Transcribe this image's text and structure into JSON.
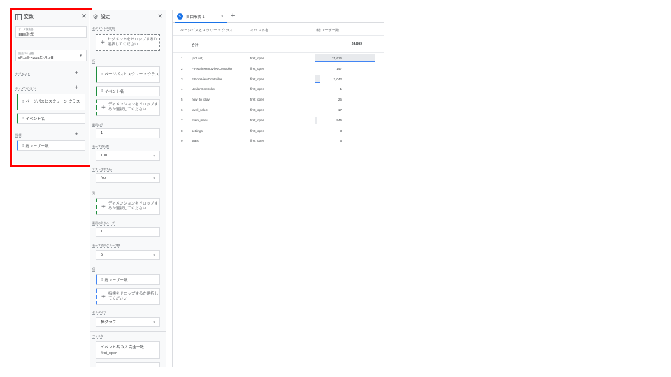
{
  "variables": {
    "title": "変数",
    "name_label": "データ探索名:",
    "name_value": "自由形式",
    "date_label": "過去 28 日間",
    "date_value": "6月13日～2025年7月10日",
    "segments_label": "セグメント",
    "dimensions_label": "ディメンション",
    "dimensions": [
      "ページパスとスクリーン クラス",
      "イベント名"
    ],
    "metrics_label": "指標",
    "metrics": [
      "総ユーザー数"
    ]
  },
  "settings": {
    "title": "設定",
    "segment_compare_label": "セグメントの比較",
    "segment_drop": "セグメントをドロップするか選択してください",
    "rows_label": "行",
    "rows": [
      "ページパスとスクリーン クラス",
      "イベント名"
    ],
    "rows_drop": "ディメンションをドロップするか選択してください",
    "start_row_label": "最初の行",
    "start_row_value": "1",
    "show_rows_label": "表示する行数",
    "show_rows_value": "100",
    "nested_rows_label": "ネストされた行",
    "nested_rows_value": "No",
    "columns_label": "列",
    "columns_drop": "ディメンションをドロップするか選択してください",
    "start_col_group_label": "最初の列グループ",
    "start_col_group_value": "1",
    "show_col_groups_label": "表示する列グループ数",
    "show_col_groups_value": "5",
    "values_label": "値",
    "values": [
      "総ユーザー数"
    ],
    "values_drop": "指標をドロップするか選択してください",
    "cell_type_label": "セルタイプ",
    "cell_type_value": "棒グラフ",
    "filters_label": "フィルタ",
    "filter_text": "イベント名 次と完全一致",
    "filter_value": "first_open"
  },
  "report": {
    "tab_label": "自由形式 1",
    "headers": {
      "col1": "ページパスとスクリーン クラス",
      "col2": "イベント名",
      "col3": "↓総ユーザー数"
    },
    "total_label": "合計",
    "total_value": "24,883",
    "rows": [
      {
        "idx": "1",
        "page": "(not set)",
        "event": "first_open",
        "users": "21,616",
        "share": 0.869
      },
      {
        "idx": "2",
        "page": "FIRMainMenuViewController",
        "event": "first_open",
        "users": "147",
        "share": 0.006
      },
      {
        "idx": "3",
        "page": "FIRootViewController",
        "event": "first_open",
        "users": "2,042",
        "share": 0.082
      },
      {
        "idx": "4",
        "page": "UIAlertController",
        "event": "first_open",
        "users": "1",
        "share": 0.0
      },
      {
        "idx": "5",
        "page": "how_to_play",
        "event": "first_open",
        "users": "25",
        "share": 0.001
      },
      {
        "idx": "6",
        "page": "level_select",
        "event": "first_open",
        "users": "17",
        "share": 0.001
      },
      {
        "idx": "7",
        "page": "main_menu",
        "event": "first_open",
        "users": "945",
        "share": 0.038
      },
      {
        "idx": "8",
        "page": "settings",
        "event": "first_open",
        "users": "3",
        "share": 0.0
      },
      {
        "idx": "9",
        "page": "stats",
        "event": "first_open",
        "users": "6",
        "share": 0.0
      }
    ]
  },
  "colors": {
    "highlight": "#ff0000",
    "accent": "#1a73e8",
    "dimension": "#1e8e3e",
    "metric": "#4285f4"
  }
}
